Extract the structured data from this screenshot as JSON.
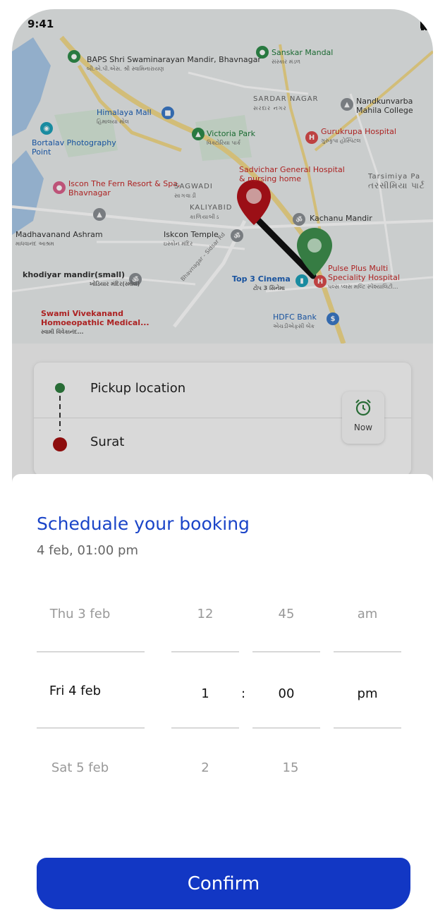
{
  "status_bar": {
    "time": "9:41"
  },
  "map": {
    "labels": {
      "baps": "BAPS Shri Swaminarayan Mandir, Bhavnagar",
      "baps_sub": "બી.એ.પી.એસ. શ્રી સ્વામિનારાયણ",
      "sanskar": "Sanskar Mandal",
      "sanskar_sub": "સંસ્કાર મંડળ",
      "sardar": "SARDAR NAGAR",
      "sardar_sub": "સરદાર નગર",
      "nandkunvarba": "Nandkunvarba Mahila College",
      "himalaya": "Himalaya Mall",
      "himalaya_sub": "હિમાલયા મોલ",
      "victoria": "Victoria Park",
      "victoria_sub": "વિક્ટોરિયા પાર્ક",
      "gurukrupa": "Gurukrupa Hospital",
      "gurukrupa_sub": "ગુરુકૃપા હોસ્પિટલ",
      "bortalav": "Bortalav Photography Point",
      "sadvichar": "Sadvichar General Hospital & nursing home",
      "tarsimiya": "Tarsimiya Pa",
      "tarsimiya_sub": "તરસીમિયા પાર્ટ",
      "iscon_fern": "Iscon The Fern Resort & Spa, Bhavnagar",
      "sagwadi": "SAGWADI",
      "sagwadi_sub": "સાગવાડી",
      "kaliyabid": "KALIYABID",
      "kaliyabid_sub": "કાળિયાબીડ",
      "kachanu": "Kachanu Mandir",
      "madhavanand": "Madhavanand Ashram",
      "madhavanand_sub": "માધવાનંદ આશ્રમ",
      "iskcon_temple": "Iskcon Temple",
      "iskcon_temple_sub": "ઇસ્કોન મંદિર",
      "khodiyar": "khodiyar mandir(small)",
      "khodiyar_sub": "ખોડિયાર મંદિર(સ્મોલ)",
      "top3": "Top 3 Cinema",
      "top3_sub": "ટોપ 3 સિનેમા",
      "pulse": "Pulse Plus Multi Speciality Hospital",
      "pulse_sub": "પલ્સ પ્લસ મલ્ટિ સ્પેશ્યાલિટી...",
      "swami": "Swami Vivekanand Homoeopathic Medical...",
      "swami_sub": "સ્વામી વિવેકાનંદ...",
      "hdfc": "HDFC Bank",
      "hdfc_sub": "એચડીએફસી બેંક",
      "road": "Bhavnagar - Sidsar Rd"
    }
  },
  "route": {
    "pickup_label": "Pickup location",
    "drop_label": "Surat",
    "now_label": "Now",
    "pickup_color": "#2e7d3e",
    "drop_color": "#a31010"
  },
  "sheet": {
    "title": "Scheduale your booking",
    "subtitle": "4 feb, 01:00 pm"
  },
  "picker": {
    "dates": [
      "Thu 3 feb",
      "Fri 4 feb",
      "Sat 5 feb"
    ],
    "hours": [
      "12",
      "1",
      "2"
    ],
    "minutes": [
      "45",
      "00",
      "15"
    ],
    "ampm": [
      "am",
      "pm"
    ],
    "separator": ":"
  },
  "confirm_label": "Confirm",
  "colors": {
    "accent": "#1237c4",
    "title": "#1a44c8"
  }
}
